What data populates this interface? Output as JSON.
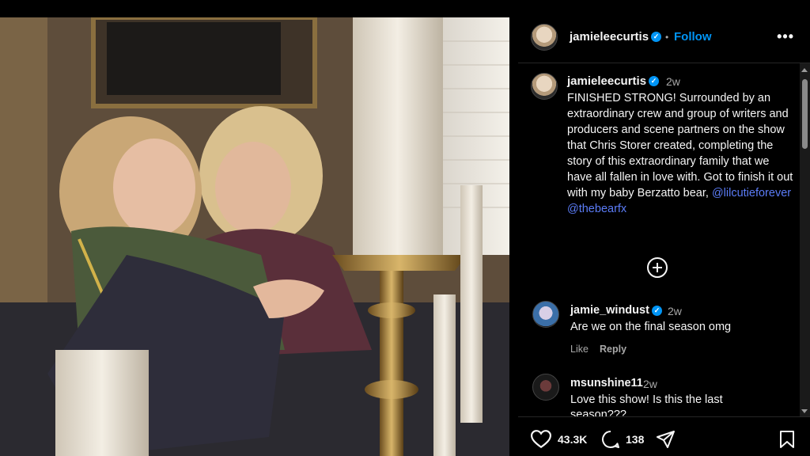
{
  "post": {
    "header_username": "jamieleecurtis",
    "header_separator": "•",
    "follow_label": "Follow",
    "more_label": "•••",
    "caption_username": "jamieleecurtis",
    "caption_time": "2w",
    "caption_text": "FINISHED STRONG! Surrounded by an extraordinary crew and group of writers and producers and scene partners on the show that Chris Storer created, completing the story of this extraordinary family that we have all fallen in love with. Got to finish it out with my baby Berzatto bear,",
    "mention_1": "@lilcutieforever",
    "mention_2": "@thebearfx"
  },
  "comments": [
    {
      "username": "jamie_windust",
      "time": "2w",
      "text": "Are we on the final season omg",
      "like_label": "Like",
      "reply_label": "Reply",
      "verified": true
    },
    {
      "username": "msunshine11",
      "time": "2w",
      "text": "Love this show! Is this the last season???",
      "verified": false
    }
  ],
  "actions": {
    "likes": "43.3K",
    "comments": "138",
    "icons": [
      "heart-icon",
      "comment-icon",
      "share-icon",
      "bookmark-icon"
    ]
  },
  "colors": {
    "background": "#000000",
    "link": "#0095f6",
    "mention": "#5b7cf7",
    "muted": "#a8a8a8"
  }
}
